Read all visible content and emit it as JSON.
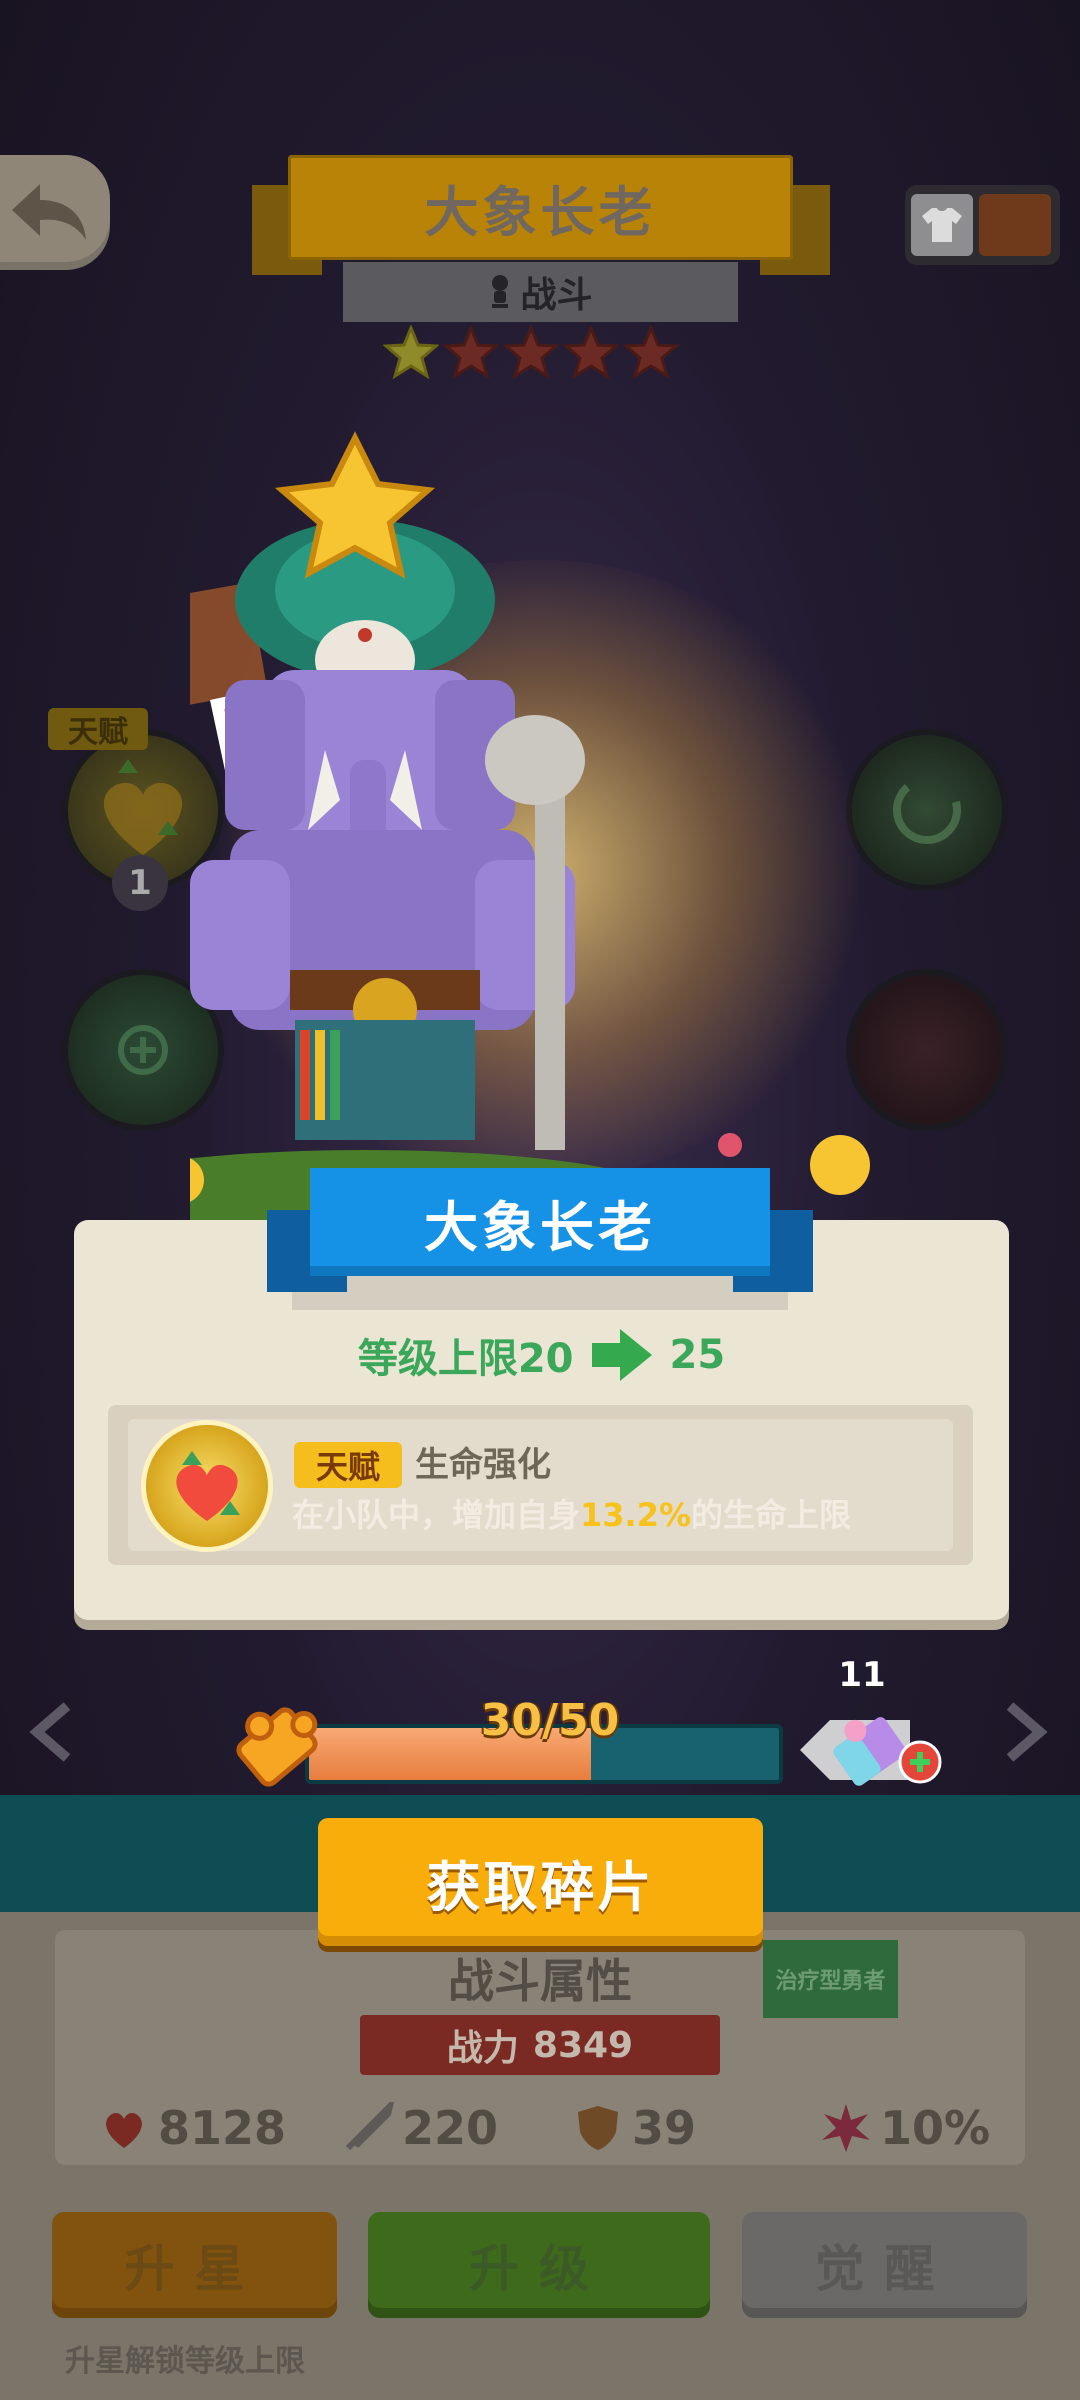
{
  "header": {
    "title": "大象长老",
    "role": "战斗",
    "stars_filled": 1,
    "stars_total": 5
  },
  "skills": {
    "talent_tag": "天赋",
    "talent_count": "1"
  },
  "result": {
    "hero_name": "大象长老",
    "level_cap_label": "等级上限20",
    "level_cap_new": "25",
    "talent_chip": "天赋",
    "talent_name": "生命强化",
    "talent_desc_pre": "在小队中，增加自身",
    "talent_desc_value": "13.2%",
    "talent_desc_post": "的生命上限"
  },
  "fragments": {
    "count_text": "30/50",
    "progress_fraction": 0.6,
    "crystal_count": "11",
    "get_button": "获取碎片"
  },
  "stats": {
    "title": "战斗属性",
    "class_tag": "治疗型勇者",
    "power_label": "战力",
    "power_value": "8349",
    "hp": "8128",
    "attack": "220",
    "defense": "39",
    "crit": "10%"
  },
  "actions": {
    "star_up": "升星",
    "level_up": "升级",
    "awaken": "觉醒",
    "star_hint": "升星解锁等级上限"
  },
  "colors": {
    "accent_gold": "#f9ad0b",
    "ribbon_blue": "#1592e6",
    "level_green": "#3aa75a",
    "highlight_yellow": "#f7c21b"
  }
}
